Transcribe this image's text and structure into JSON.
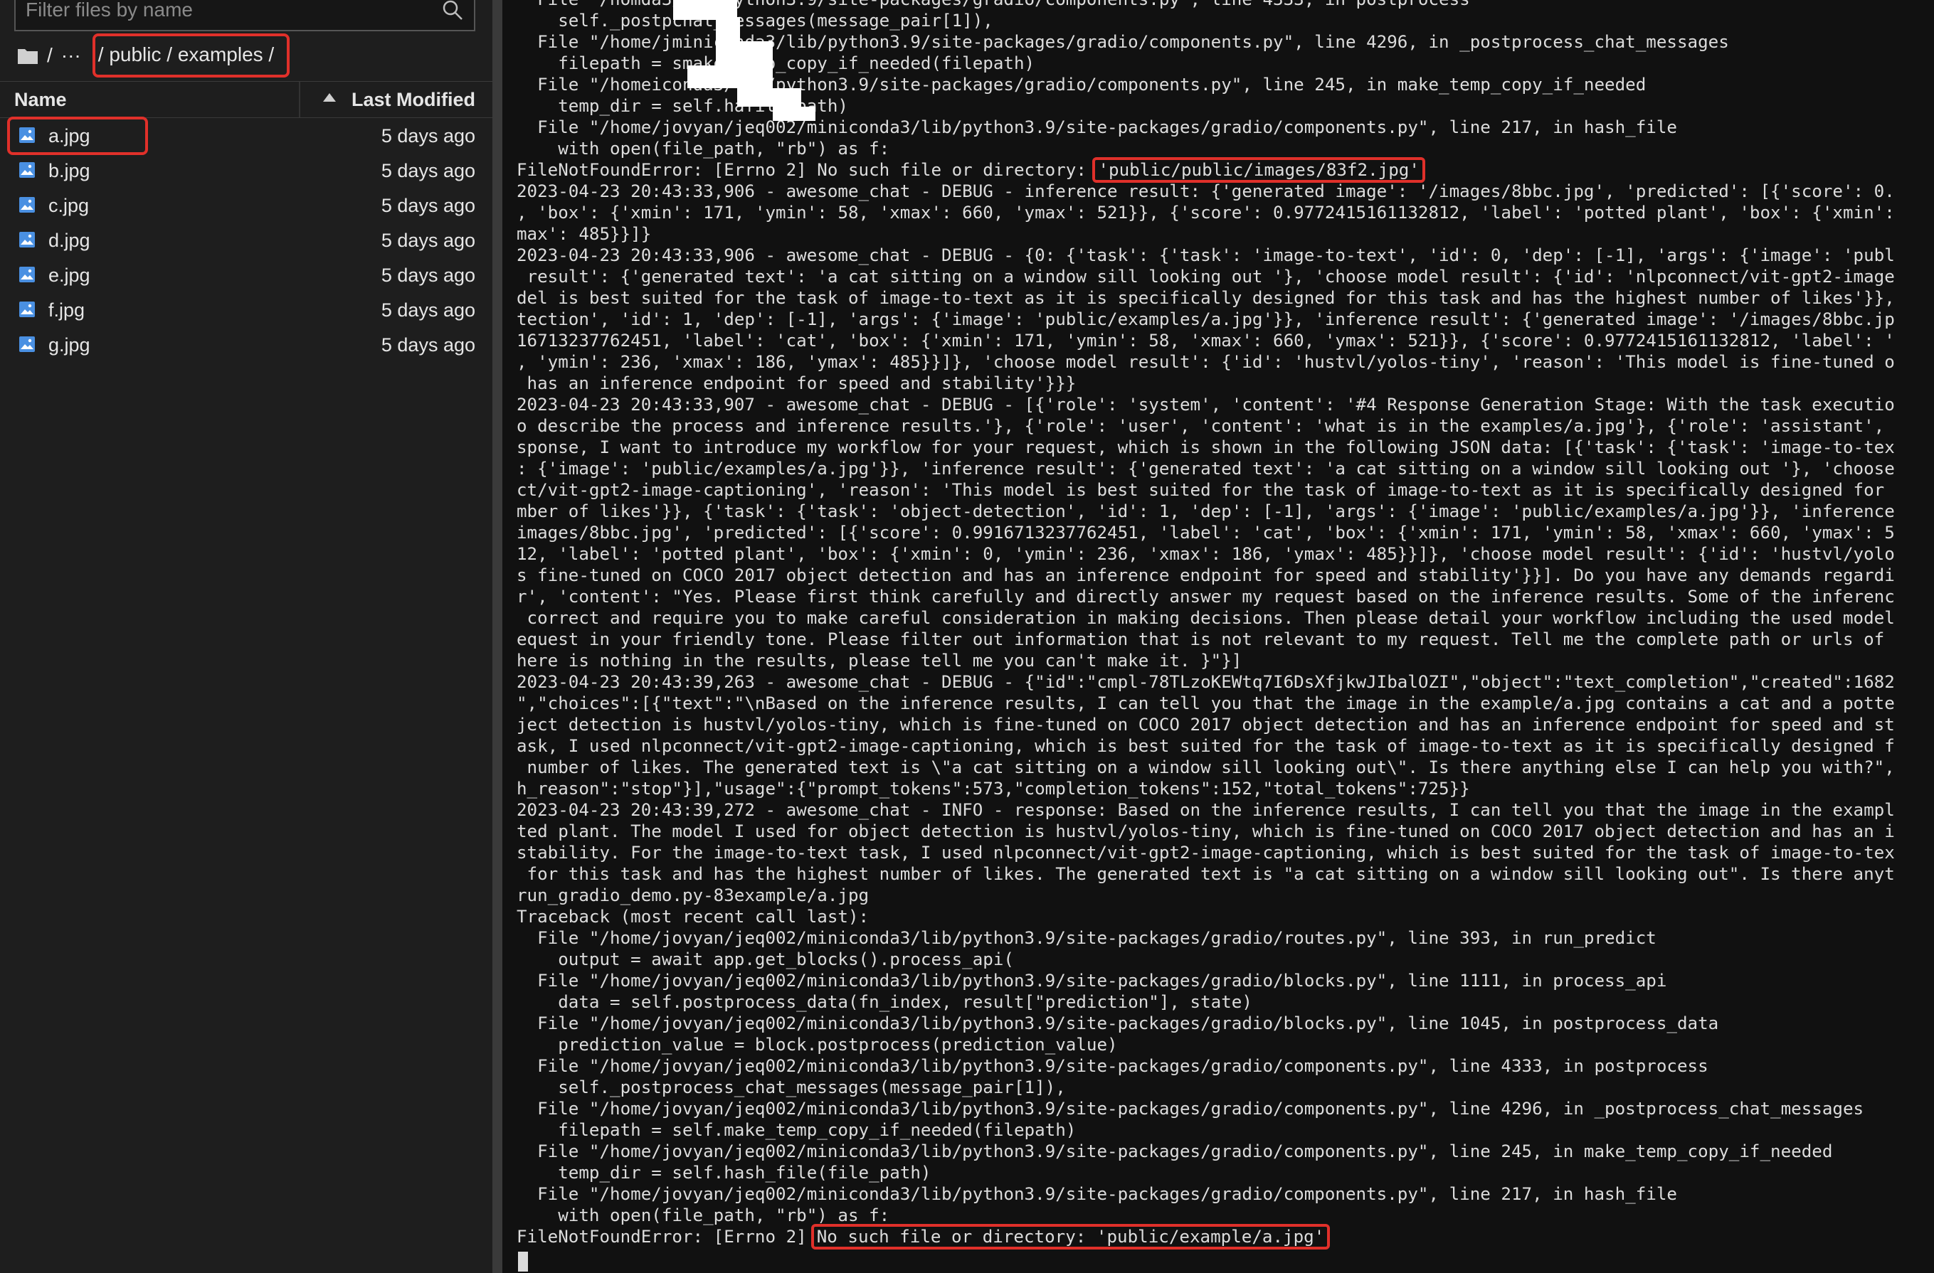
{
  "filebrowser": {
    "search_placeholder": "Filter files by name",
    "breadcrumb": {
      "root": "/",
      "ellipsis": "···",
      "path": "/ public / examples /"
    },
    "columns": {
      "name": "Name",
      "modified": "Last Modified"
    },
    "files": [
      {
        "name": "a.jpg",
        "modified": "5 days ago"
      },
      {
        "name": "b.jpg",
        "modified": "5 days ago"
      },
      {
        "name": "c.jpg",
        "modified": "5 days ago"
      },
      {
        "name": "d.jpg",
        "modified": "5 days ago"
      },
      {
        "name": "e.jpg",
        "modified": "5 days ago"
      },
      {
        "name": "f.jpg",
        "modified": "5 days ago"
      },
      {
        "name": "g.jpg",
        "modified": "5 days ago"
      }
    ]
  },
  "terminal": {
    "lines": [
      "  File \"/hom",
      "    self._postp",
      "  File \"/home/j",
      "    filepath = s",
      "  File \"/home",
      "    temp_dir = self.ha",
      "  File \"/home/jovyan/jeq002/miniconda3/lib/python3.9/site-packages/gradio/components.py\", line 217, in hash_file",
      "    with open(file_path, \"rb\") as f:",
      "FileNotFoundError: [Errno 2] No such file or directory:",
      "2023-04-23 20:43:33,906 - awesome_chat - DEBUG - inference result: {'generated image': '/images/8bbc.jpg', 'predicted': [{'score': 0.",
      ", 'box': {'xmin': 171, 'ymin': 58, 'xmax': 660, 'ymax': 521}}, {'score': 0.9772415161132812, 'label': 'potted plant', 'box': {'xmin':",
      "max': 485}}]}",
      "2023-04-23 20:43:33,906 - awesome_chat - DEBUG - {0: {'task': {'task': 'image-to-text', 'id': 0, 'dep': [-1], 'args': {'image': 'publ",
      " result': {'generated text': 'a cat sitting on a window sill looking out '}, 'choose model result': {'id': 'nlpconnect/vit-gpt2-image",
      "del is best suited for the task of image-to-text as it is specifically designed for this task and has the highest number of likes'}},",
      "tection', 'id': 1, 'dep': [-1], 'args': {'image': 'public/examples/a.jpg'}}, 'inference result': {'generated image': '/images/8bbc.jp",
      "16713237762451, 'label': 'cat', 'box': {'xmin': 171, 'ymin': 58, 'xmax': 660, 'ymax': 521}}, {'score': 0.9772415161132812, 'label': '",
      ", 'ymin': 236, 'xmax': 186, 'ymax': 485}}]}, 'choose model result': {'id': 'hustvl/yolos-tiny', 'reason': 'This model is fine-tuned o",
      " has an inference endpoint for speed and stability'}}}",
      "2023-04-23 20:43:33,907 - awesome_chat - DEBUG - [{'role': 'system', 'content': '#4 Response Generation Stage: With the task executio",
      "o describe the process and inference results.'}, {'role': 'user', 'content': 'what is in the examples/a.jpg'}, {'role': 'assistant',",
      "sponse, I want to introduce my workflow for your request, which is shown in the following JSON data: [{'task': {'task': 'image-to-tex",
      ": {'image': 'public/examples/a.jpg'}}, 'inference result': {'generated text': 'a cat sitting on a window sill looking out '}, 'choose",
      "ct/vit-gpt2-image-captioning', 'reason': 'This model is best suited for the task of image-to-text as it is specifically designed for",
      "mber of likes'}}, {'task': {'task': 'object-detection', 'id': 1, 'dep': [-1], 'args': {'image': 'public/examples/a.jpg'}}, 'inference",
      "images/8bbc.jpg', 'predicted': [{'score': 0.9916713237762451, 'label': 'cat', 'box': {'xmin': 171, 'ymin': 58, 'xmax': 660, 'ymax': 5",
      "12, 'label': 'potted plant', 'box': {'xmin': 0, 'ymin': 236, 'xmax': 186, 'ymax': 485}}]}, 'choose model result': {'id': 'hustvl/yolo",
      "s fine-tuned on COCO 2017 object detection and has an inference endpoint for speed and stability'}}]. Do you have any demands regardi",
      "r', 'content': \"Yes. Please first think carefully and directly answer my request based on the inference results. Some of the inferenc",
      " correct and require you to make careful consideration in making decisions. Then please detail your workflow including the used model",
      "equest in your friendly tone. Please filter out information that is not relevant to my request. Tell me the complete path or urls of",
      "here is nothing in the results, please tell me you can't make it. }\"}]",
      "2023-04-23 20:43:39,263 - awesome_chat - DEBUG - {\"id\":\"cmpl-78TLzoKEWtq7I6DsXfjkwJIbalOZI\",\"object\":\"text_completion\",\"created\":1682",
      "\",\"choices\":[{\"text\":\"\\nBased on the inference results, I can tell you that the image in the example/a.jpg contains a cat and a potte",
      "ject detection is hustvl/yolos-tiny, which is fine-tuned on COCO 2017 object detection and has an inference endpoint for speed and st",
      "ask, I used nlpconnect/vit-gpt2-image-captioning, which is best suited for the task of image-to-text as it is specifically designed f",
      " number of likes. The generated text is \\\"a cat sitting on a window sill looking out\\\". Is there anything else I can help you with?\",",
      "h_reason\":\"stop\"}],\"usage\":{\"prompt_tokens\":573,\"completion_tokens\":152,\"total_tokens\":725}}",
      "2023-04-23 20:43:39,272 - awesome_chat - INFO - response: Based on the inference results, I can tell you that the image in the exampl",
      "ted plant. The model I used for object detection is hustvl/yolos-tiny, which is fine-tuned on COCO 2017 object detection and has an i",
      "stability. For the image-to-text task, I used nlpconnect/vit-gpt2-image-captioning, which is best suited for the task of image-to-tex",
      " for this task and has the highest number of likes. The generated text is \"a cat sitting on a window sill looking out\". Is there anyt",
      "run_gradio_demo.py-83example/a.jpg",
      "Traceback (most recent call last):",
      "  File \"/home/jovyan/jeq002/miniconda3/lib/python3.9/site-packages/gradio/routes.py\", line 393, in run_predict",
      "    output = await app.get_blocks().process_api(",
      "  File \"/home/jovyan/jeq002/miniconda3/lib/python3.9/site-packages/gradio/blocks.py\", line 1111, in process_api",
      "    data = self.postprocess_data(fn_index, result[\"prediction\"], state)",
      "  File \"/home/jovyan/jeq002/miniconda3/lib/python3.9/site-packages/gradio/blocks.py\", line 1045, in postprocess_data",
      "    prediction_value = block.postprocess(prediction_value)",
      "  File \"/home/jovyan/jeq002/miniconda3/lib/python3.9/site-packages/gradio/components.py\", line 4333, in postprocess",
      "    self._postprocess_chat_messages(message_pair[1]),",
      "  File \"/home/jovyan/jeq002/miniconda3/lib/python3.9/site-packages/gradio/components.py\", line 4296, in _postprocess_chat_messages",
      "    filepath = self.make_temp_copy_if_needed(filepath)",
      "  File \"/home/jovyan/jeq002/miniconda3/lib/python3.9/site-packages/gradio/components.py\", line 245, in make_temp_copy_if_needed",
      "    temp_dir = self.hash_file(file_path)",
      "  File \"/home/jovyan/jeq002/miniconda3/lib/python3.9/site-packages/gradio/components.py\", line 217, in hash_file",
      "    with open(file_path, \"rb\") as f:",
      "FileNotFoundError: [Errno 2]"
    ],
    "line0_tail": "da3/lib/python3.9/site-packages/gradio/components.py\", line 4333, in postprocess",
    "line1_tail": "chat_messages(message_pair[1]),",
    "line2_tail": "miniconda3/lib/python3.9/site-packages/gradio/components.py\", line 4296, in _postprocess_chat_messages",
    "line3_tail": "make_temp_copy_if_needed(filepath)",
    "line4_tail": "iconda3/lib/python3.9/site-packages/gradio/components.py\", line 245, in make_temp_copy_if_needed",
    "line5_tail": "file_path)",
    "highlight_1": "'public/public/images/83f2.jpg'",
    "highlight_2": "No such file or directory: 'public/example/a.jpg'"
  },
  "colors": {
    "highlight": "#e0302a",
    "file_icon": "#4a90e2"
  }
}
